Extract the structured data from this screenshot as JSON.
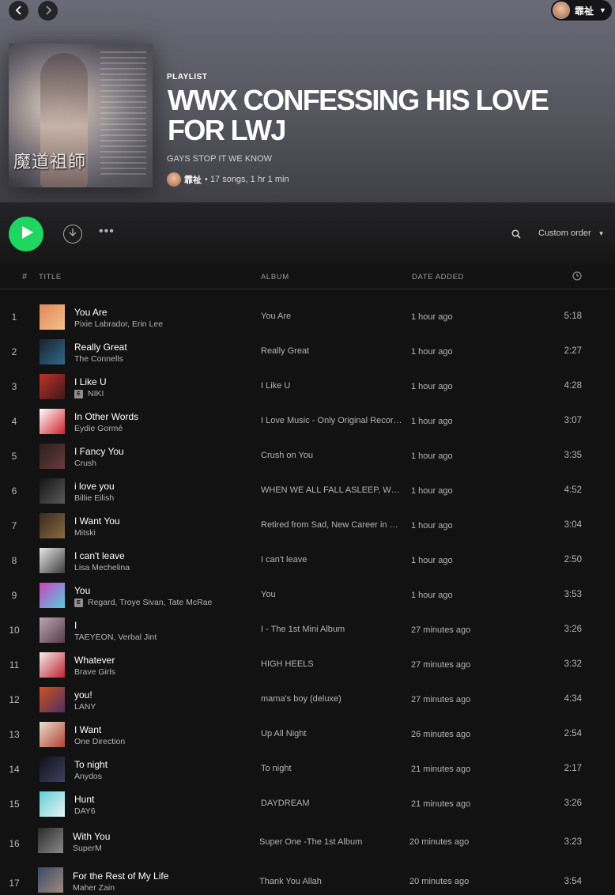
{
  "header": {
    "type_label": "PLAYLIST",
    "title": "WWX CONFESSING HIS LOVE FOR LWJ",
    "description": "GAYS STOP IT WE KNOW",
    "owner": "霏祉",
    "stats": "• 17 songs, 1 hr 1 min",
    "cover_text": "魔道祖師"
  },
  "user": {
    "name": "霏祉"
  },
  "toolbar": {
    "sort_label": "Custom order"
  },
  "columns": {
    "num": "#",
    "title": "TITLE",
    "album": "ALBUM",
    "date_added": "DATE ADDED"
  },
  "tracks": [
    {
      "n": "1",
      "title": "You Are",
      "artist": "Pixie Labrador, Erin Lee",
      "explicit": false,
      "album": "You Are",
      "added": "1 hour ago",
      "duration": "5:18",
      "art": [
        "#e0895a",
        "#f3c08a"
      ]
    },
    {
      "n": "2",
      "title": "Really Great",
      "artist": "The Connells",
      "explicit": false,
      "album": "Really Great",
      "added": "1 hour ago",
      "duration": "2:27",
      "art": [
        "#1a2230",
        "#2f6a8a"
      ]
    },
    {
      "n": "3",
      "title": "I Like U",
      "artist": "NIKI",
      "explicit": true,
      "album": "I Like U",
      "added": "1 hour ago",
      "duration": "4:28",
      "art": [
        "#c2302a",
        "#3a1a1a"
      ]
    },
    {
      "n": "4",
      "title": "In Other Words",
      "artist": "Eydie Gormé",
      "explicit": false,
      "album": "I Love Music - Only Original Recordings",
      "added": "1 hour ago",
      "duration": "3:07",
      "art": [
        "#ffffff",
        "#d0202a"
      ]
    },
    {
      "n": "5",
      "title": "I Fancy You",
      "artist": "Crush",
      "explicit": false,
      "album": "Crush on You",
      "added": "1 hour ago",
      "duration": "3:35",
      "art": [
        "#2a2020",
        "#6a3a3a"
      ]
    },
    {
      "n": "6",
      "title": "i love you",
      "artist": "Billie Eilish",
      "explicit": false,
      "album": "WHEN WE ALL FALL ASLEEP, WHERE DO WE GO?",
      "added": "1 hour ago",
      "duration": "4:52",
      "art": [
        "#141414",
        "#5a5a5a"
      ]
    },
    {
      "n": "7",
      "title": "I Want You",
      "artist": "Mitski",
      "explicit": false,
      "album": "Retired from Sad, New Career in Business",
      "added": "1 hour ago",
      "duration": "3:04",
      "art": [
        "#3a2a20",
        "#8a6a40"
      ]
    },
    {
      "n": "8",
      "title": "I can't leave",
      "artist": "Lisa Mechelina",
      "explicit": false,
      "album": "I can't leave",
      "added": "1 hour ago",
      "duration": "2:50",
      "art": [
        "#e8e8e8",
        "#3a3a3a"
      ]
    },
    {
      "n": "9",
      "title": "You",
      "artist": "Regard, Troye Sivan, Tate McRae",
      "explicit": true,
      "album": "You",
      "added": "1 hour ago",
      "duration": "3:53",
      "art": [
        "#d040c0",
        "#50d0e0"
      ]
    },
    {
      "n": "10",
      "title": "I",
      "artist": "TAEYEON, Verbal Jint",
      "explicit": false,
      "album": "I - The 1st Mini Album",
      "added": "27 minutes ago",
      "duration": "3:26",
      "art": [
        "#b8a8b0",
        "#5a3a4a"
      ]
    },
    {
      "n": "11",
      "title": "Whatever",
      "artist": "Brave Girls",
      "explicit": false,
      "album": "HIGH HEELS",
      "added": "27 minutes ago",
      "duration": "3:32",
      "art": [
        "#f4eeee",
        "#c02030"
      ]
    },
    {
      "n": "12",
      "title": "you!",
      "artist": "LANY",
      "explicit": false,
      "album": "mama's boy (deluxe)",
      "added": "27 minutes ago",
      "duration": "4:34",
      "art": [
        "#d05020",
        "#4a3060"
      ]
    },
    {
      "n": "13",
      "title": "I Want",
      "artist": "One Direction",
      "explicit": false,
      "album": "Up All Night",
      "added": "26 minutes ago",
      "duration": "2:54",
      "art": [
        "#e8e0d0",
        "#b04030"
      ]
    },
    {
      "n": "14",
      "title": "To night",
      "artist": "Anydos",
      "explicit": false,
      "album": "To night",
      "added": "21 minutes ago",
      "duration": "2:17",
      "art": [
        "#101018",
        "#404060"
      ]
    },
    {
      "n": "15",
      "title": "Hunt",
      "artist": "DAY6",
      "explicit": false,
      "album": "DAYDREAM",
      "added": "21 minutes ago",
      "duration": "3:26",
      "art": [
        "#60d0d8",
        "#e8f4f4"
      ]
    },
    {
      "n": "16",
      "title": "With You",
      "artist": "SuperM",
      "explicit": false,
      "album": "Super One -The 1st Album",
      "added": "20 minutes ago",
      "duration": "3:23",
      "art": [
        "#2a2a2a",
        "#8a8a8a"
      ]
    },
    {
      "n": "17",
      "title": "For the Rest of My Life",
      "artist": "Maher Zain",
      "explicit": false,
      "album": "Thank You Allah",
      "added": "20 minutes ago",
      "duration": "3:54",
      "art": [
        "#3a4a6a",
        "#a08a7a"
      ]
    }
  ],
  "colors": {
    "accent": "#1ed760",
    "background": "#121212",
    "header_top": "#6b6b78"
  },
  "icons": {
    "back": "chevron-left-icon",
    "forward": "chevron-right-icon",
    "play": "play-icon",
    "download": "download-icon",
    "more": "more-icon",
    "search": "search-icon",
    "duration": "clock-icon"
  }
}
